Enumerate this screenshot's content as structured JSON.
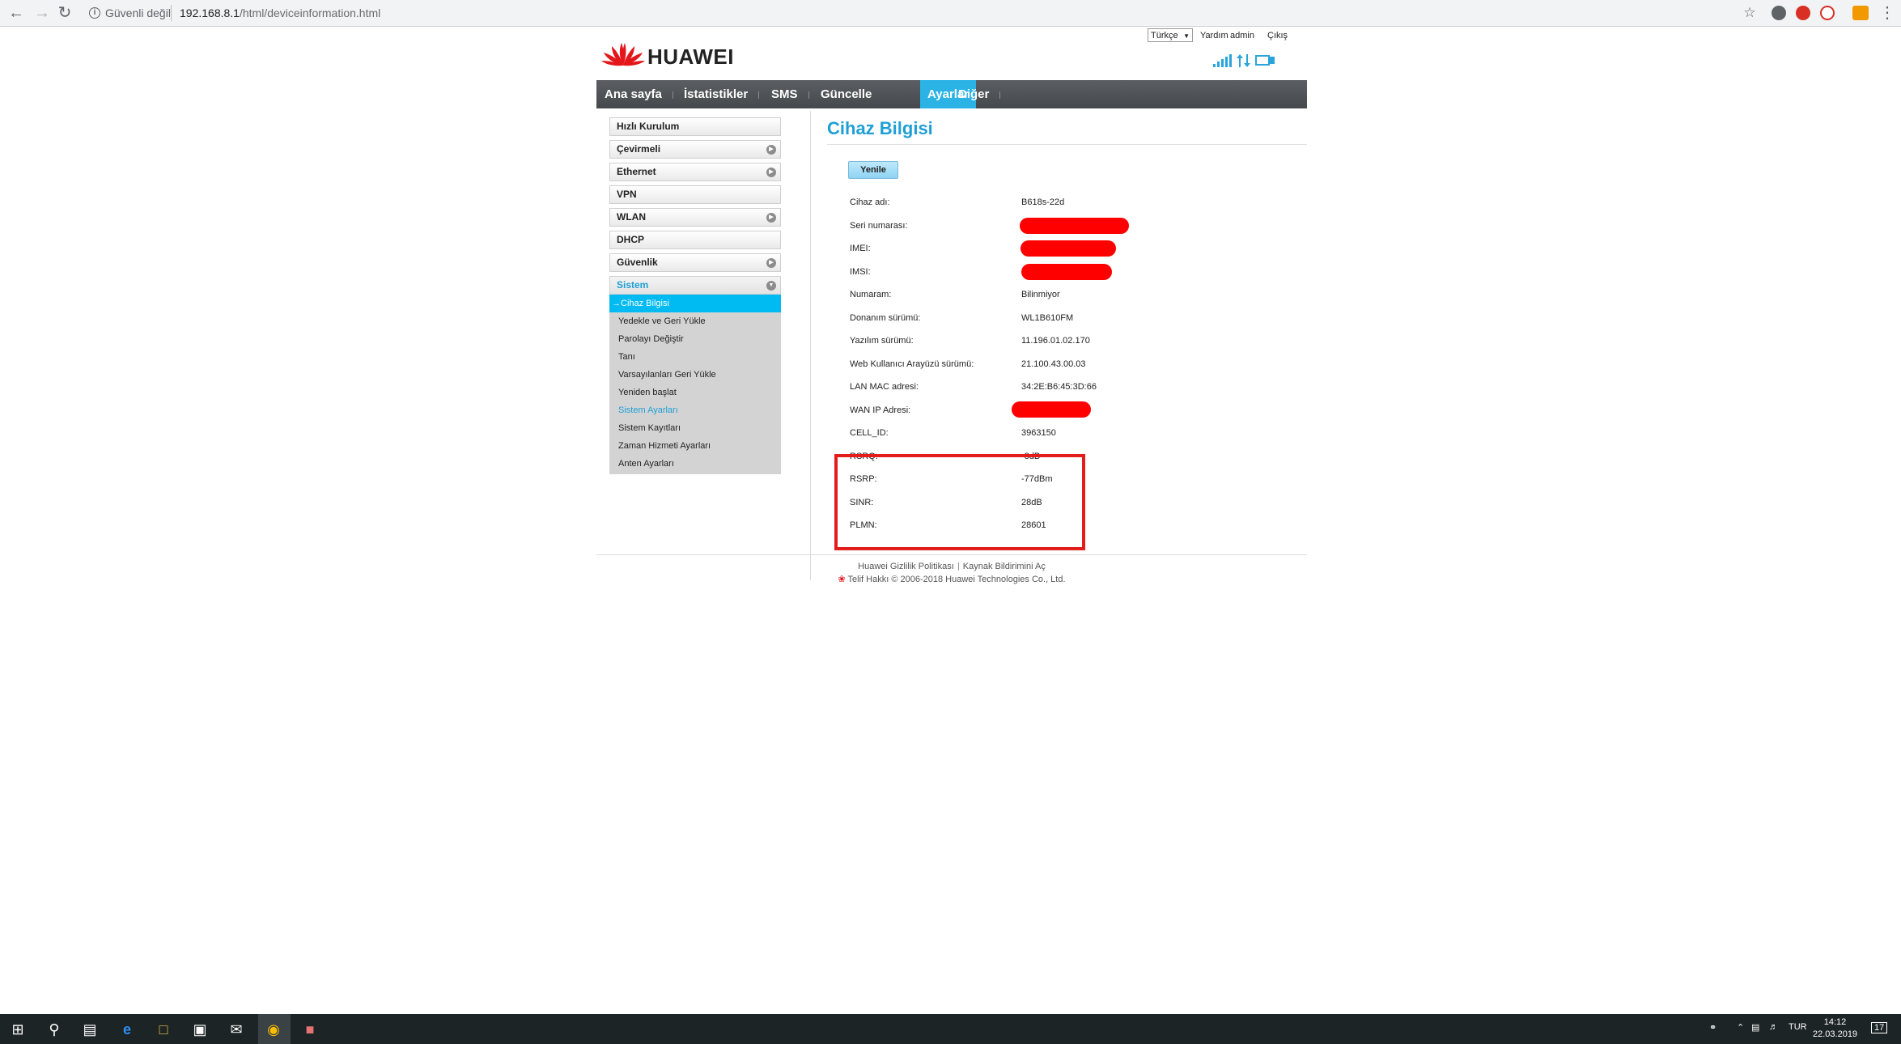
{
  "browser": {
    "not_secure": "Güvenli değil",
    "url_host": "192.168.8.1",
    "url_path": "/html/deviceinformation.html"
  },
  "header": {
    "logo_text": "HUAWEI",
    "language": "Türkçe",
    "help": "Yardım",
    "user": "admin",
    "logout": "Çıkış"
  },
  "nav": {
    "items": [
      "Ana sayfa",
      "İstatistikler",
      "SMS",
      "Güncelle",
      "Ayarlar",
      "Diğer"
    ],
    "active_index": 4
  },
  "sidebar": {
    "items": [
      "Hızlı Kurulum",
      "Çevirmeli",
      "Ethernet",
      "VPN",
      "WLAN",
      "DHCP",
      "Güvenlik",
      "Sistem"
    ],
    "submenu": [
      "Cihaz Bilgisi",
      "Yedekle ve Geri Yükle",
      "Parolayı Değiştir",
      "Tanı",
      "Varsayılanları Geri Yükle",
      "Yeniden başlat",
      "Sistem Ayarları",
      "Sistem Kayıtları",
      "Zaman Hizmeti Ayarları",
      "Anten Ayarları"
    ]
  },
  "content": {
    "title": "Cihaz Bilgisi",
    "refresh_button": "Yenile",
    "rows": [
      {
        "label": "Cihaz adı:",
        "value": "B618s-22d"
      },
      {
        "label": "Seri numarası:",
        "value": ""
      },
      {
        "label": "IMEI:",
        "value": ""
      },
      {
        "label": "IMSI:",
        "value": ""
      },
      {
        "label": "Numaram:",
        "value": "Bilinmiyor"
      },
      {
        "label": "Donanım sürümü:",
        "value": "WL1B610FM"
      },
      {
        "label": "Yazılım sürümü:",
        "value": "11.196.01.02.170"
      },
      {
        "label": "Web Kullanıcı Arayüzü sürümü:",
        "value": "21.100.43.00.03"
      },
      {
        "label": "LAN MAC adresi:",
        "value": "34:2E:B6:45:3D:66"
      },
      {
        "label": "WAN IP Adresi:",
        "value": ""
      },
      {
        "label": "CELL_ID:",
        "value": "3963150"
      },
      {
        "label": "RSRQ:",
        "value": "-8dB"
      },
      {
        "label": "RSRP:",
        "value": "-77dBm"
      },
      {
        "label": "SINR:",
        "value": "28dB"
      },
      {
        "label": "PLMN:",
        "value": "28601"
      }
    ]
  },
  "footer": {
    "privacy": "Huawei Gizlilik Politikası",
    "open_source": "Kaynak Bildirimini Aç",
    "copyright": "Telif Hakkı © 2006-2018 Huawei Technologies Co., Ltd."
  },
  "taskbar": {
    "language": "TUR",
    "time": "14:12",
    "date": "22.03.2019",
    "notification_count": "17"
  },
  "colors": {
    "accent": "#1f9fd6",
    "nav_active": "#2bb3e6",
    "submenu_active": "#00baf2",
    "redaction": "#ff0000",
    "highlight_box": "#e31c1c"
  }
}
